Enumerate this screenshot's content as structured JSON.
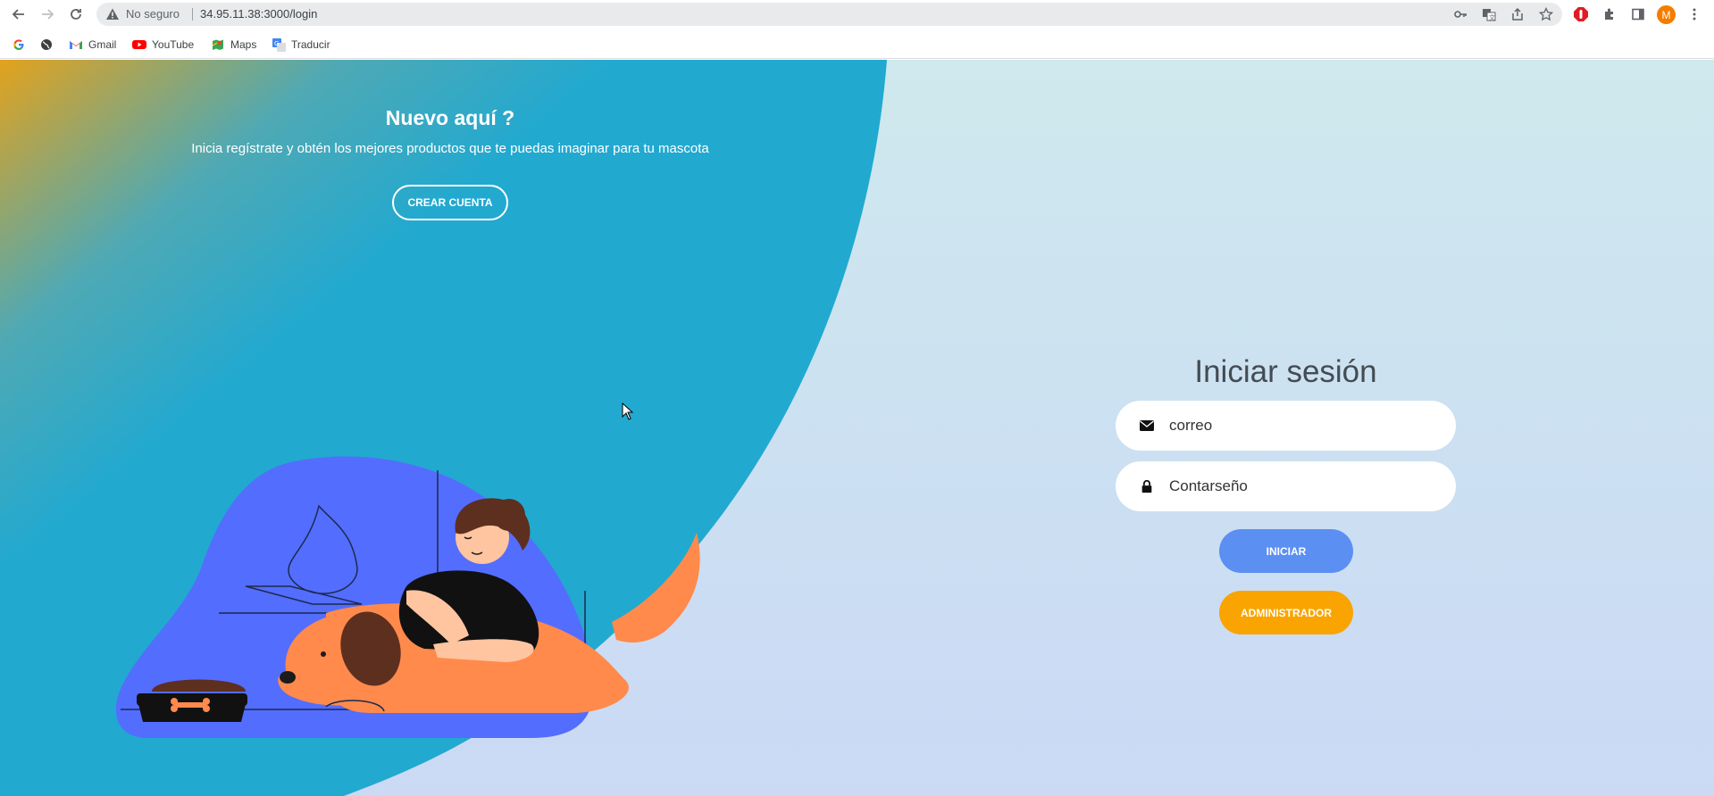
{
  "browser": {
    "security_label": "No seguro",
    "url": "34.95.11.38:3000/login",
    "profile_initial": "M",
    "bookmarks": [
      {
        "label": "",
        "icon": "google-icon"
      },
      {
        "label": "",
        "icon": "globe-icon"
      },
      {
        "label": "Gmail",
        "icon": "gmail-icon"
      },
      {
        "label": "YouTube",
        "icon": "youtube-icon"
      },
      {
        "label": "Maps",
        "icon": "maps-icon"
      },
      {
        "label": "Traducir",
        "icon": "translate-icon"
      }
    ]
  },
  "welcome": {
    "title": "Nuevo aquí ?",
    "text": "Inicia regístrate y obtén los mejores productos que te puedas imaginar para tu mascota",
    "create_account_label": "CREAR CUENTA"
  },
  "login": {
    "title": "Iniciar sesión",
    "email_placeholder": "correo",
    "password_placeholder": "Contarseño",
    "login_button_label": "INICIAR",
    "admin_button_label": "ADMINISTRADOR"
  },
  "colors": {
    "blue_panel": "#22a9d0",
    "login_button": "#5b8ff1",
    "admin_button": "#f9a400",
    "illustration_blob": "#536dfe",
    "dog": "#ff8a4c"
  }
}
